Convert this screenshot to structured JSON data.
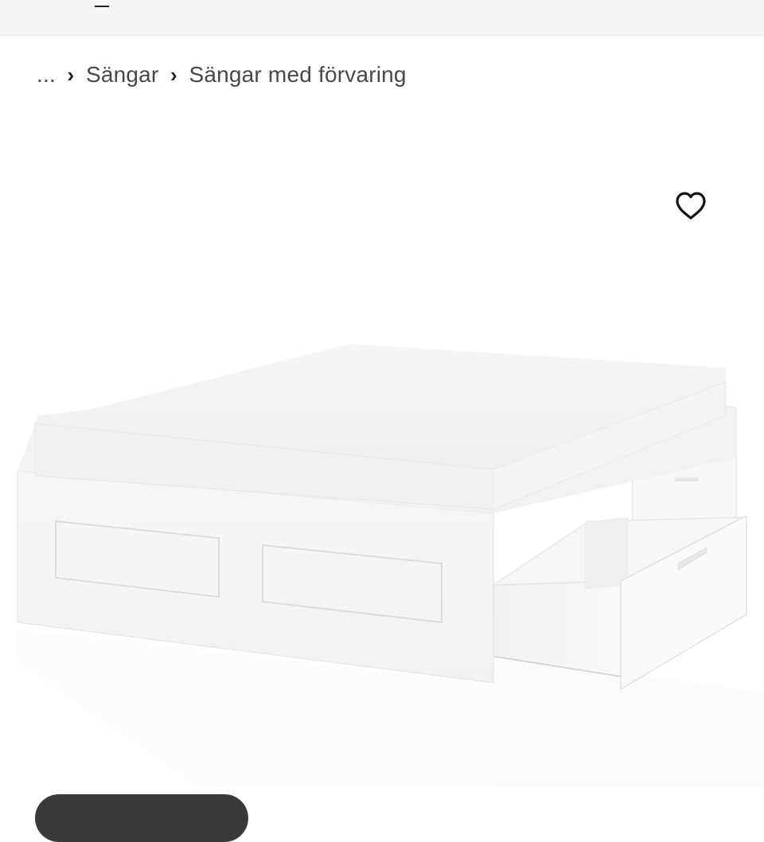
{
  "breadcrumb": {
    "ellipsis": "...",
    "items": [
      {
        "label": "Sängar"
      },
      {
        "label": "Sängar med förvaring"
      }
    ],
    "separator": "›"
  },
  "product": {
    "image_icon": "bed-frame-with-storage-image",
    "favorite_icon": "heart-outline-icon"
  },
  "colors": {
    "top_bar": "#f5f5f5",
    "text": "#484848",
    "icon": "#111111",
    "pill": "#3a3a3a"
  }
}
